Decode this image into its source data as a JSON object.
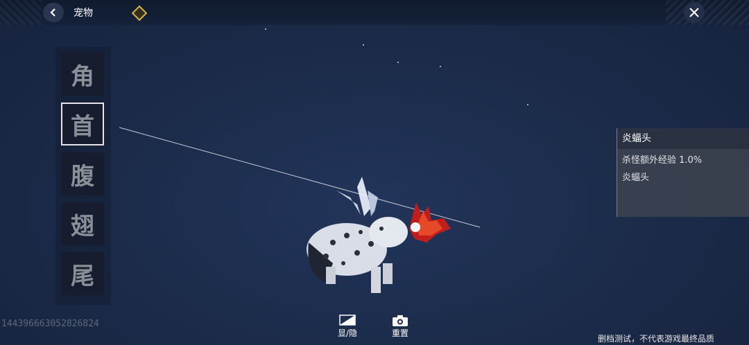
{
  "header": {
    "title": "宠物",
    "back_icon": "back-arrow-icon",
    "badge_icon": "diamond-badge-icon",
    "close_icon": "close-icon"
  },
  "part_list": {
    "items": [
      {
        "label": "角",
        "selected": false
      },
      {
        "label": "首",
        "selected": true
      },
      {
        "label": "腹",
        "selected": false
      },
      {
        "label": "翅",
        "selected": false
      },
      {
        "label": "尾",
        "selected": false
      }
    ]
  },
  "info_panel": {
    "title": "炎蝠头",
    "effect": "杀怪额外经验 1.0%",
    "name": "炎蝠头"
  },
  "bottom_buttons": {
    "toggle_label": "显/隐",
    "reset_label": "重置"
  },
  "debug_id": "1443966630528268​24",
  "disclaimer": "删档测试，不代表游戏最终品质",
  "colors": {
    "background": "#1c2c4b",
    "badge_gold": "#d7b24a",
    "selected_border": "#e6e6e6"
  }
}
